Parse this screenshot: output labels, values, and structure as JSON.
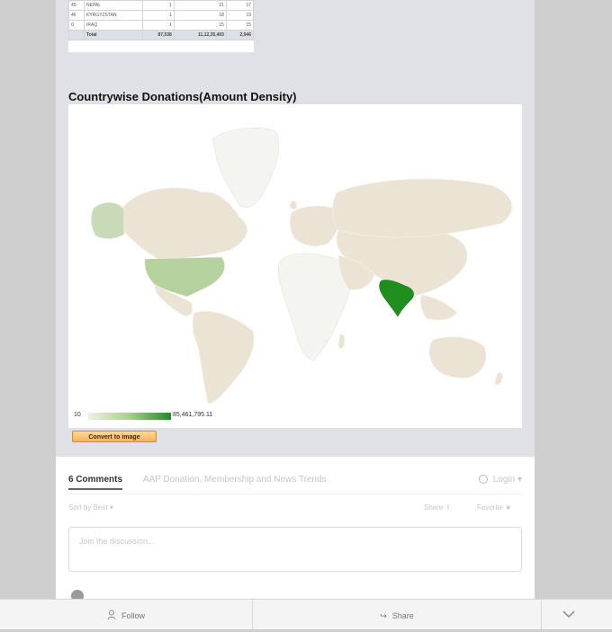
{
  "donation_table": {
    "rows": [
      {
        "rank": "45",
        "country": "NEPAL",
        "count": "1",
        "amount": "21",
        "donors": "17"
      },
      {
        "rank": "46",
        "country": "KYRGYZSTAN",
        "count": "1",
        "amount": "18",
        "donors": "19"
      },
      {
        "rank": "0",
        "country": "IRAQ",
        "count": "1",
        "amount": "15",
        "donors": "15"
      }
    ],
    "total": {
      "label": "Total",
      "count": "87,538",
      "amount": "11,12,35,403",
      "donors": "2,946"
    }
  },
  "section": {
    "title": "Countrywise Donations(Amount Density)"
  },
  "map": {
    "legend_min": "10",
    "legend_max": "85,461,795.11",
    "colors": {
      "low": "#f2f0e4",
      "mid": "#a9cf8f",
      "high": "#1e8e1e",
      "no_data": "#f7f7f7",
      "land": "#e9e2d0"
    }
  },
  "convert_button": {
    "label": "Convert to image"
  },
  "comments": {
    "count_label": "6 Comments",
    "site_label": "AAP Donation, Membership and News Trends",
    "login_label": "Login",
    "sort_label": "Sort by Best",
    "share_label": "Share",
    "favorite_label": "Favorite",
    "discussion_placeholder": "Join the discussion..."
  },
  "bottom_bar": {
    "follow_label": "Follow",
    "share_label": "Share"
  }
}
